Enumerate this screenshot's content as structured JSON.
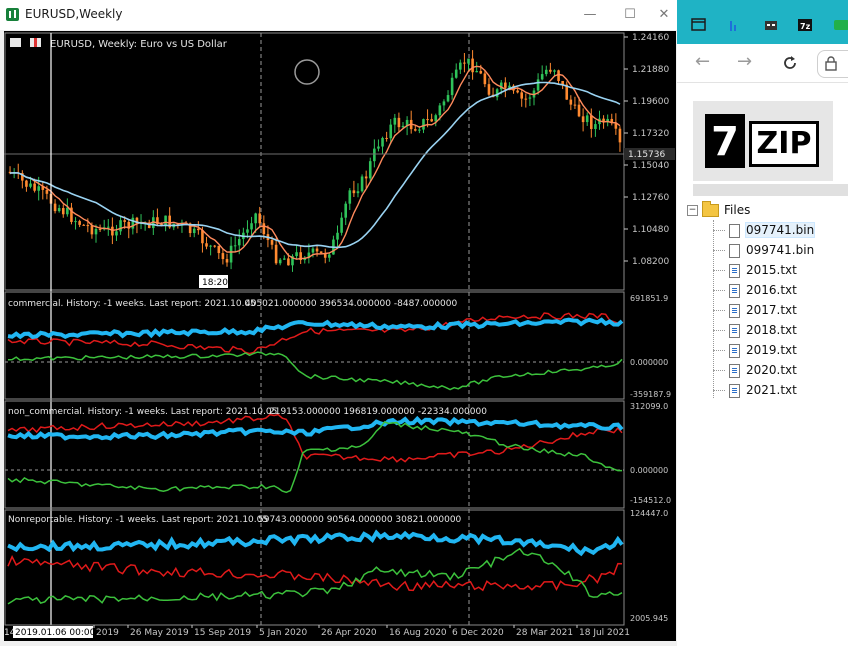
{
  "window": {
    "title": "EURUSD,Weekly",
    "controls": {
      "minimize": "—",
      "maximize": "☐",
      "close": "✕"
    }
  },
  "chart": {
    "symbol_label": "EURUSD, Weekly:  Euro vs US Dollar",
    "current_price": "1.15736",
    "price_levels": [
      "1.24160",
      "1.21880",
      "1.19600",
      "1.17320",
      "1.15040",
      "1.12760",
      "1.10480",
      "1.08200"
    ],
    "crosshair_time": "18:20",
    "date_labels": [
      "2019",
      "26 May 2019",
      "15 Sep 2019",
      "5 Jan 2020",
      "26 Apr 2020",
      "16 Aug 2020",
      "6 Dec 2020",
      "28 Mar 2021",
      "18 Jul 2021"
    ],
    "first_date_prefix": "14",
    "selected_date": "2019.01.06 00:00",
    "colors": {
      "background": "#000000",
      "bull": "#2fc35a",
      "bear": "#ff8a30",
      "ma_fast": "#ff8a5c",
      "ma_slow": "#9ad3f2",
      "axis": "#c8c8c8"
    }
  },
  "indicators": [
    {
      "label": "commercial. History: -1 weeks. Last report: 2021.10.05",
      "values": "405021.000000 396534.000000 -8487.000000",
      "max": "691851.9",
      "zero": "0.000000",
      "min": "-359187.9"
    },
    {
      "label": "non_commercial. History: -1 weeks. Last report: 2021.10.05",
      "values": "219153.000000 196819.000000 -22334.000000",
      "max": "312099.0",
      "zero": "0.000000",
      "min": "-154512.0"
    },
    {
      "label": "Nonreportable. History: -1 weeks. Last report: 2021.10.05",
      "values": "59743.000000 90564.000000 30821.000000",
      "max": "124447.0",
      "min": "2005.945"
    }
  ],
  "browser": {
    "logo_seven": "7",
    "logo_zip": "ZIP",
    "tree_root": "Files",
    "files": [
      {
        "name": "097741.bin",
        "type": "bin",
        "selected": true
      },
      {
        "name": "099741.bin",
        "type": "bin",
        "selected": false
      },
      {
        "name": "2015.txt",
        "type": "txt",
        "selected": false
      },
      {
        "name": "2016.txt",
        "type": "txt",
        "selected": false
      },
      {
        "name": "2017.txt",
        "type": "txt",
        "selected": false
      },
      {
        "name": "2018.txt",
        "type": "txt",
        "selected": false
      },
      {
        "name": "2019.txt",
        "type": "txt",
        "selected": false
      },
      {
        "name": "2020.txt",
        "type": "txt",
        "selected": false
      },
      {
        "name": "2021.txt",
        "type": "txt",
        "selected": false
      }
    ]
  }
}
